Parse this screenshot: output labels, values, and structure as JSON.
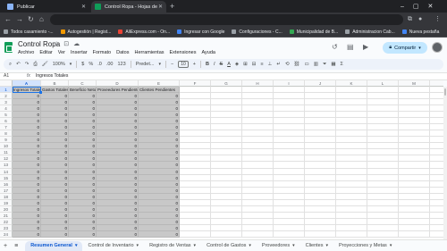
{
  "browser": {
    "tabs": [
      {
        "title": "Publicar",
        "active": false
      },
      {
        "title": "Control Ropa - Hojas de cálculo",
        "active": true
      }
    ],
    "bookmarks": [
      "Todos casamiento -...",
      "Autogestión | Regist...",
      "AliExpress.com - On...",
      "Ingresar con Google",
      "Configuraciones - C...",
      "Municipalidad de B...",
      "Administracion Cab...",
      "Nueva pestaña"
    ]
  },
  "doc": {
    "title": "Control Ropa",
    "menu": [
      "Archivo",
      "Editar",
      "Ver",
      "Insertar",
      "Formato",
      "Datos",
      "Herramientas",
      "Extensiones",
      "Ayuda"
    ],
    "share_label": "Compartir"
  },
  "toolbar": {
    "zoom": "100%",
    "currency": "$",
    "percent": "%",
    "dec_dec": ".0",
    "dec_inc": ".00",
    "num_fmt": "123",
    "font": "Predet...",
    "minus": "−",
    "font_size": "10",
    "plus": "+"
  },
  "formula_bar": {
    "cell_ref": "A1",
    "fx": "fx",
    "content": "Ingresos Totales"
  },
  "grid": {
    "columns": [
      "A",
      "B",
      "C",
      "D",
      "E",
      "F",
      "G",
      "H",
      "I",
      "J",
      "K",
      "L",
      "M",
      "N"
    ],
    "headers": [
      "Ingresos Totales",
      "Gastos Totales",
      "Beneficio Neto",
      "Proveedores Pendientes",
      "Clientes Pendientes"
    ],
    "rows": [
      "1",
      "2",
      "3",
      "4",
      "5",
      "6",
      "7",
      "8",
      "9",
      "10",
      "11",
      "12",
      "13",
      "14",
      "15",
      "16",
      "17",
      "18",
      "19",
      "20",
      "21",
      "22",
      "23",
      "24"
    ],
    "zero": "0"
  },
  "sheets": [
    {
      "label": "Resumen General",
      "active": true
    },
    {
      "label": "Control de Inventario",
      "active": false
    },
    {
      "label": "Registro de Ventas",
      "active": false
    },
    {
      "label": "Control de Gastos",
      "active": false
    },
    {
      "label": "Proveedores",
      "active": false
    },
    {
      "label": "Clientes",
      "active": false
    },
    {
      "label": "Proyecciones y Metas",
      "active": false
    }
  ],
  "colors": {
    "sheets_green": "#0f9d58",
    "share_blue": "#c2e7ff",
    "selection_blue": "#1a73e8",
    "shaded_cell": "#c8c8c8"
  }
}
